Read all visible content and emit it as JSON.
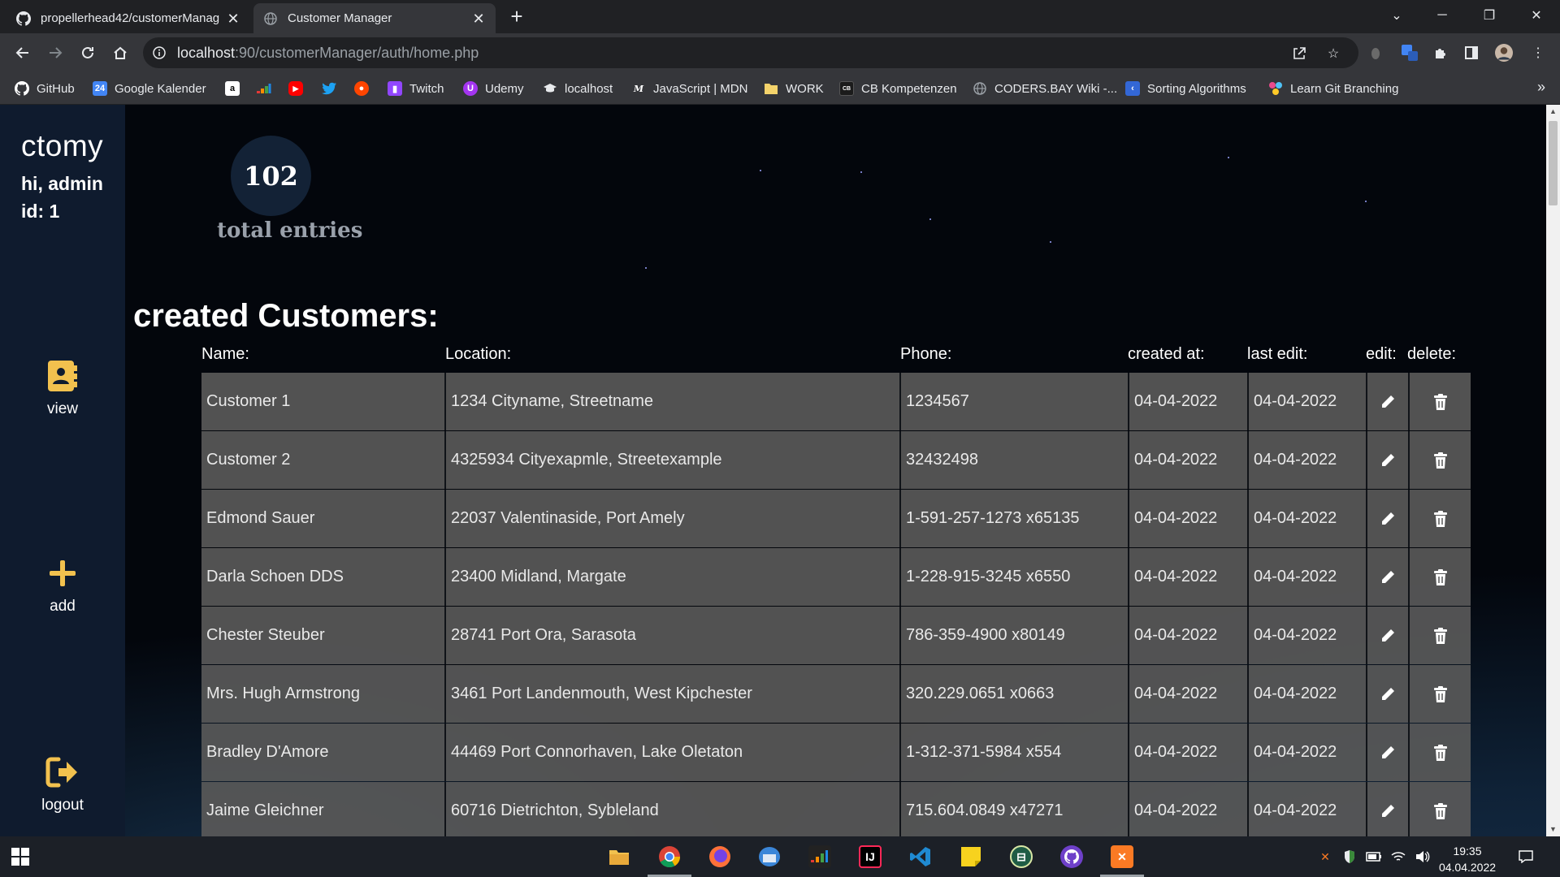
{
  "browser": {
    "tabs": [
      {
        "title": "propellerhead42/customerManag",
        "active": false
      },
      {
        "title": "Customer Manager",
        "active": true
      }
    ],
    "url_host": "localhost",
    "url_path": ":90/customerManager/auth/home.php",
    "bookmarks": [
      {
        "label": "GitHub",
        "icon": "github-icon",
        "color": "#ffffff"
      },
      {
        "label": "Google Kalender",
        "icon": "calendar-icon",
        "color": "#4285f4"
      },
      {
        "label": "",
        "icon": "amazon-icon",
        "color": "#ffffff"
      },
      {
        "label": "",
        "icon": "deezer-icon",
        "color": "#ef5466"
      },
      {
        "label": "",
        "icon": "youtube-icon",
        "color": "#ff0000"
      },
      {
        "label": "",
        "icon": "twitter-icon",
        "color": "#1da1f2"
      },
      {
        "label": "",
        "icon": "reddit-icon",
        "color": "#ff4500"
      },
      {
        "label": "Twitch",
        "icon": "twitch-icon",
        "color": "#9146ff"
      },
      {
        "label": "Udemy",
        "icon": "udemy-icon",
        "color": "#a435f0"
      },
      {
        "label": "localhost",
        "icon": "graduation-cap-icon",
        "color": "#e8eaed"
      },
      {
        "label": "JavaScript | MDN",
        "icon": "mdn-icon",
        "color": "#ffffff"
      },
      {
        "label": "WORK",
        "icon": "folder-icon",
        "color": "#f4d36b"
      },
      {
        "label": "CB Kompetenzen",
        "icon": "cb-icon",
        "color": "#1b1b1b"
      },
      {
        "label": "CODERS.BAY Wiki -...",
        "icon": "globe-icon",
        "color": "#9aa0a6"
      },
      {
        "label": "Sorting Algorithms",
        "icon": "sorting-icon",
        "color": "#3367d6"
      },
      {
        "label": "Learn Git Branching",
        "icon": "git-icon",
        "color": "#e94b8c"
      }
    ]
  },
  "app": {
    "brand": "ctomy",
    "greeting": "hi, admin",
    "user_id": "id: 1",
    "nav": [
      {
        "label": "view",
        "icon": "contact-book-icon"
      },
      {
        "label": "add",
        "icon": "plus-icon"
      },
      {
        "label": "logout",
        "icon": "logout-icon"
      }
    ],
    "stats": {
      "total": "102",
      "label": "total entries"
    },
    "section_title": "created Customers:",
    "table": {
      "headers": [
        "Name:",
        "Location:",
        "Phone:",
        "created at:",
        "last edit:",
        "edit:",
        "delete:"
      ],
      "rows": [
        {
          "name": "Customer 1",
          "location": "1234 Cityname, Streetname",
          "phone": "1234567",
          "created": "04-04-2022",
          "edited": "04-04-2022"
        },
        {
          "name": "Customer 2",
          "location": "4325934 Cityexapmle, Streetexample",
          "phone": "32432498",
          "created": "04-04-2022",
          "edited": "04-04-2022"
        },
        {
          "name": "Edmond Sauer",
          "location": "22037 Valentinaside, Port Amely",
          "phone": "1-591-257-1273 x65135",
          "created": "04-04-2022",
          "edited": "04-04-2022"
        },
        {
          "name": "Darla Schoen DDS",
          "location": "23400 Midland, Margate",
          "phone": "1-228-915-3245 x6550",
          "created": "04-04-2022",
          "edited": "04-04-2022"
        },
        {
          "name": "Chester Steuber",
          "location": "28741 Port Ora, Sarasota",
          "phone": "786-359-4900 x80149",
          "created": "04-04-2022",
          "edited": "04-04-2022"
        },
        {
          "name": "Mrs. Hugh Armstrong",
          "location": "3461 Port Landenmouth, West Kipchester",
          "phone": "320.229.0651 x0663",
          "created": "04-04-2022",
          "edited": "04-04-2022"
        },
        {
          "name": "Bradley D'Amore",
          "location": "44469 Port Connorhaven, Lake Oletaton",
          "phone": "1-312-371-5984 x554",
          "created": "04-04-2022",
          "edited": "04-04-2022"
        },
        {
          "name": "Jaime Gleichner",
          "location": "60716 Dietrichton, Sybleland",
          "phone": "715.604.0849 x47271",
          "created": "04-04-2022",
          "edited": "04-04-2022"
        }
      ]
    }
  },
  "taskbar": {
    "apps": [
      {
        "icon": "file-explorer-icon",
        "color": "#f2c14e"
      },
      {
        "icon": "chrome-icon",
        "color": "#4285f4"
      },
      {
        "icon": "firefox-icon",
        "color": "#ff7139"
      },
      {
        "icon": "thunderbird-icon",
        "color": "#3b86d8"
      },
      {
        "icon": "deezer-icon",
        "color": "#222222"
      },
      {
        "icon": "intellij-icon",
        "color": "#000000"
      },
      {
        "icon": "vscode-icon",
        "color": "#1f8ad2"
      },
      {
        "icon": "sticky-notes-icon",
        "color": "#f7d21e"
      },
      {
        "icon": "spreadsheet-icon",
        "color": "#1f5c45"
      },
      {
        "icon": "github-desktop-icon",
        "color": "#6e40c9"
      },
      {
        "icon": "xampp-icon",
        "color": "#fb7a24"
      }
    ],
    "time": "19:35",
    "date": "04.04.2022"
  }
}
